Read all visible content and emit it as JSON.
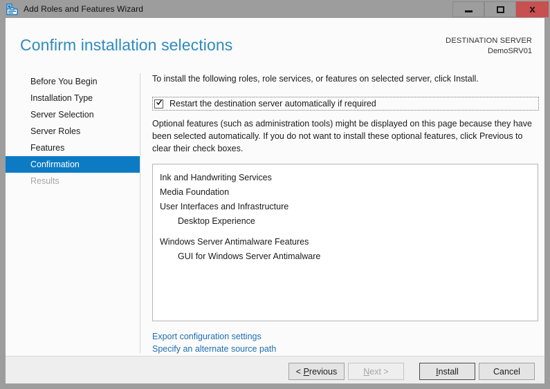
{
  "window": {
    "title": "Add Roles and Features Wizard",
    "icon": "wizard-server-icon",
    "controls": {
      "minimize": "–",
      "maximize": "□",
      "close": "x"
    }
  },
  "header": {
    "page_title": "Confirm installation selections",
    "destination_label": "DESTINATION SERVER",
    "destination_value": "DemoSRV01"
  },
  "sidebar": {
    "items": [
      {
        "label": "Before You Begin",
        "state": "normal"
      },
      {
        "label": "Installation Type",
        "state": "normal"
      },
      {
        "label": "Server Selection",
        "state": "normal"
      },
      {
        "label": "Server Roles",
        "state": "normal"
      },
      {
        "label": "Features",
        "state": "normal"
      },
      {
        "label": "Confirmation",
        "state": "selected"
      },
      {
        "label": "Results",
        "state": "disabled"
      }
    ]
  },
  "content": {
    "intro": "To install the following roles, role services, or features on selected server, click Install.",
    "restart_checkbox": {
      "label": "Restart the destination server automatically if required",
      "checked": true
    },
    "optional_note": "Optional features (such as administration tools) might be displayed on this page because they have been selected automatically. If you do not want to install these optional features, click Previous to clear their check boxes.",
    "features": [
      {
        "label": "Ink and Handwriting Services",
        "level": 0,
        "group_gap": false
      },
      {
        "label": "Media Foundation",
        "level": 0,
        "group_gap": false
      },
      {
        "label": "User Interfaces and Infrastructure",
        "level": 0,
        "group_gap": false
      },
      {
        "label": "Desktop Experience",
        "level": 1,
        "group_gap": false
      },
      {
        "label": "Windows Server Antimalware Features",
        "level": 0,
        "group_gap": true
      },
      {
        "label": "GUI for Windows Server Antimalware",
        "level": 1,
        "group_gap": false
      }
    ],
    "links": [
      {
        "label": "Export configuration settings"
      },
      {
        "label": "Specify an alternate source path"
      }
    ]
  },
  "footer": {
    "buttons": [
      {
        "id": "previous",
        "label": "< Previous",
        "state": "normal",
        "accel": "P"
      },
      {
        "id": "next",
        "label": "Next >",
        "state": "disabled",
        "accel": "N"
      },
      {
        "id": "install",
        "label": "Install",
        "state": "default",
        "accel": "I"
      },
      {
        "id": "cancel",
        "label": "Cancel",
        "state": "normal",
        "accel": ""
      }
    ]
  },
  "colors": {
    "accent_blue": "#0d7bc4",
    "title_blue": "#2e8bc0",
    "link_blue": "#1f6fb2",
    "close_red": "#c75050",
    "frame_gray": "#9d9d9d"
  }
}
